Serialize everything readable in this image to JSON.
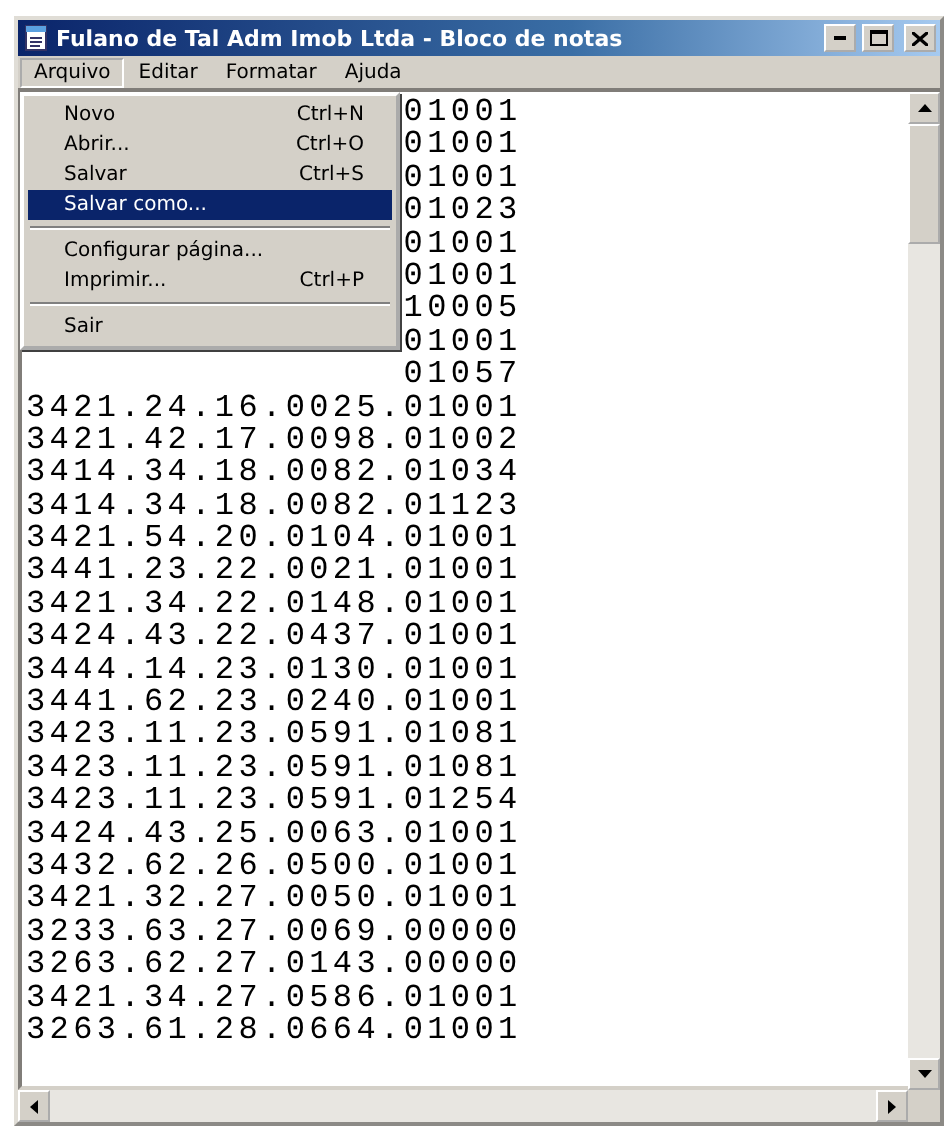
{
  "window": {
    "title": "Fulano de Tal Adm Imob Ltda - Bloco de notas"
  },
  "menu_bar": [
    {
      "label": "Arquivo",
      "selected": true
    },
    {
      "label": "Editar",
      "selected": false
    },
    {
      "label": "Formatar",
      "selected": false
    },
    {
      "label": "Ajuda",
      "selected": false
    }
  ],
  "file_menu": [
    {
      "kind": "item",
      "label": "Novo",
      "shortcut": "Ctrl+N",
      "selected": false
    },
    {
      "kind": "item",
      "label": "Abrir...",
      "shortcut": "Ctrl+O",
      "selected": false
    },
    {
      "kind": "item",
      "label": "Salvar",
      "shortcut": "Ctrl+S",
      "selected": false
    },
    {
      "kind": "item",
      "label": "Salvar como...",
      "selected": true
    },
    {
      "kind": "separator"
    },
    {
      "kind": "item",
      "label": "Configurar página...",
      "selected": false
    },
    {
      "kind": "item",
      "label": "Imprimir...",
      "shortcut": "Ctrl+P",
      "selected": false
    },
    {
      "kind": "separator"
    },
    {
      "kind": "item",
      "label": "Sair",
      "selected": false
    }
  ],
  "lines": [
    {
      "kind": "covered",
      "text": "01001"
    },
    {
      "kind": "covered",
      "text": "01001"
    },
    {
      "kind": "covered",
      "text": "01001"
    },
    {
      "kind": "covered",
      "text": "01023"
    },
    {
      "kind": "covered",
      "text": "01001"
    },
    {
      "kind": "covered",
      "text": "01001"
    },
    {
      "kind": "covered",
      "text": "10005"
    },
    {
      "kind": "covered",
      "text": "01001"
    },
    {
      "kind": "covered",
      "text": "01057"
    },
    {
      "kind": "full",
      "text": "3421.24.16.0025.01001"
    },
    {
      "kind": "full",
      "text": "3421.42.17.0098.01002"
    },
    {
      "kind": "full",
      "text": "3414.34.18.0082.01034"
    },
    {
      "kind": "full",
      "text": "3414.34.18.0082.01123"
    },
    {
      "kind": "full",
      "text": "3421.54.20.0104.01001"
    },
    {
      "kind": "full",
      "text": "3441.23.22.0021.01001"
    },
    {
      "kind": "full",
      "text": "3421.34.22.0148.01001"
    },
    {
      "kind": "full",
      "text": "3424.43.22.0437.01001"
    },
    {
      "kind": "full",
      "text": "3444.14.23.0130.01001"
    },
    {
      "kind": "full",
      "text": "3441.62.23.0240.01001"
    },
    {
      "kind": "full",
      "text": "3423.11.23.0591.01081"
    },
    {
      "kind": "full",
      "text": "3423.11.23.0591.01081"
    },
    {
      "kind": "full",
      "text": "3423.11.23.0591.01254"
    },
    {
      "kind": "full",
      "text": "3424.43.25.0063.01001"
    },
    {
      "kind": "full",
      "text": "3432.62.26.0500.01001"
    },
    {
      "kind": "full",
      "text": "3421.32.27.0050.01001"
    },
    {
      "kind": "full",
      "text": "3233.63.27.0069.00000"
    },
    {
      "kind": "full",
      "text": "3263.62.27.0143.00000"
    },
    {
      "kind": "full",
      "text": "3421.34.27.0586.01001"
    },
    {
      "kind": "full",
      "text": "3263.61.28.0664.01001"
    }
  ]
}
